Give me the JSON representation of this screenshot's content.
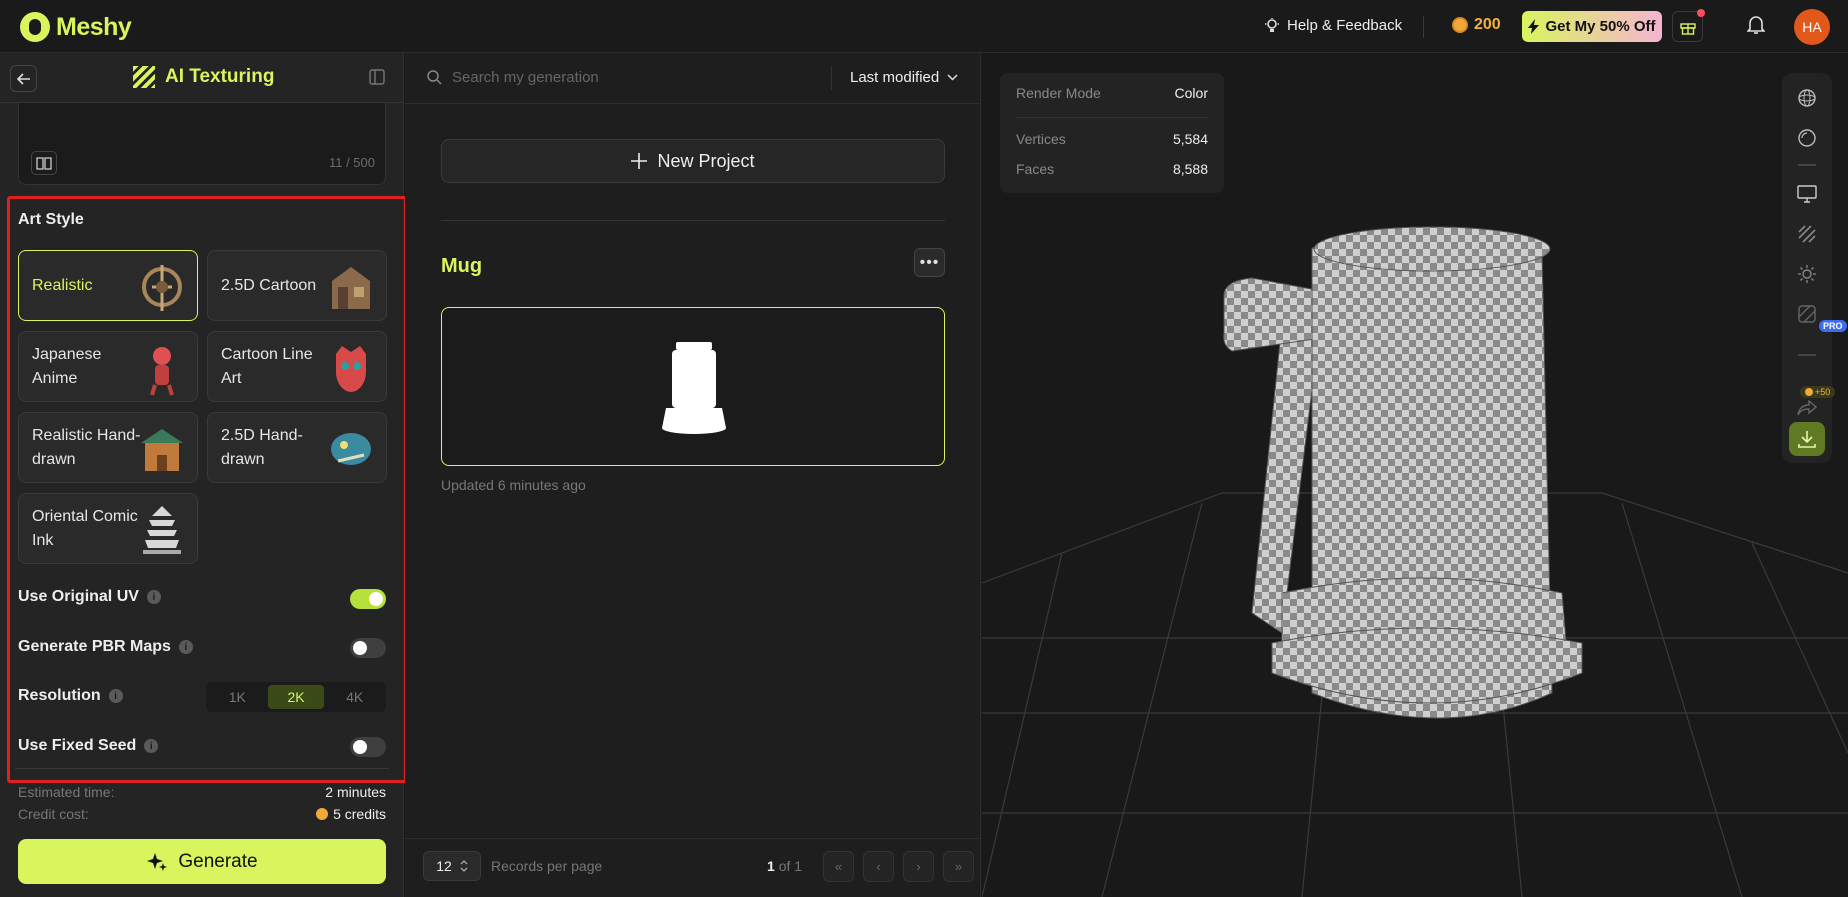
{
  "topbar": {
    "brand": "Meshy",
    "help_label": "Help & Feedback",
    "credits": "200",
    "offer_label": "Get My 50% Off",
    "avatar_initials": "HA"
  },
  "left_panel": {
    "title": "AI Texturing",
    "prompt_count": "11 / 500",
    "art_style_title": "Art Style",
    "styles": [
      {
        "label": "Realistic",
        "selected": true
      },
      {
        "label": "2.5D Cartoon",
        "selected": false
      },
      {
        "label": "Japanese Anime",
        "selected": false
      },
      {
        "label": "Cartoon Line Art",
        "selected": false
      },
      {
        "label": "Realistic Hand-drawn",
        "selected": false
      },
      {
        "label": "2.5D Hand-drawn",
        "selected": false
      },
      {
        "label": "Oriental Comic Ink",
        "selected": false
      }
    ],
    "options": {
      "original_uv": {
        "label": "Use Original UV",
        "on": true
      },
      "pbr_maps": {
        "label": "Generate PBR Maps",
        "on": false
      },
      "resolution": {
        "label": "Resolution",
        "choices": [
          "1K",
          "2K",
          "4K"
        ],
        "selected": "2K"
      },
      "fixed_seed": {
        "label": "Use Fixed Seed",
        "on": false
      }
    },
    "estimated_time_label": "Estimated time:",
    "estimated_time_value": "2 minutes",
    "credit_cost_label": "Credit cost:",
    "credit_cost_value": "5 credits",
    "generate_label": "Generate"
  },
  "middle_panel": {
    "search_placeholder": "Search my generation",
    "sort_label": "Last modified",
    "new_project_label": "New Project",
    "project_title": "Mug",
    "updated_text": "Updated 6 minutes ago",
    "per_page_value": "12",
    "per_page_label": "Records per page",
    "page_current": "1",
    "page_of": "of 1"
  },
  "viewer": {
    "render_mode_label": "Render Mode",
    "render_mode_value": "Color",
    "vertices_label": "Vertices",
    "vertices_value": "5,584",
    "faces_label": "Faces",
    "faces_value": "8,588",
    "pro_badge": "PRO",
    "share_bonus": "+50"
  },
  "colors": {
    "accent": "#d8f55e",
    "highlight_border": "#e02020",
    "avatar": "#e0581a"
  }
}
